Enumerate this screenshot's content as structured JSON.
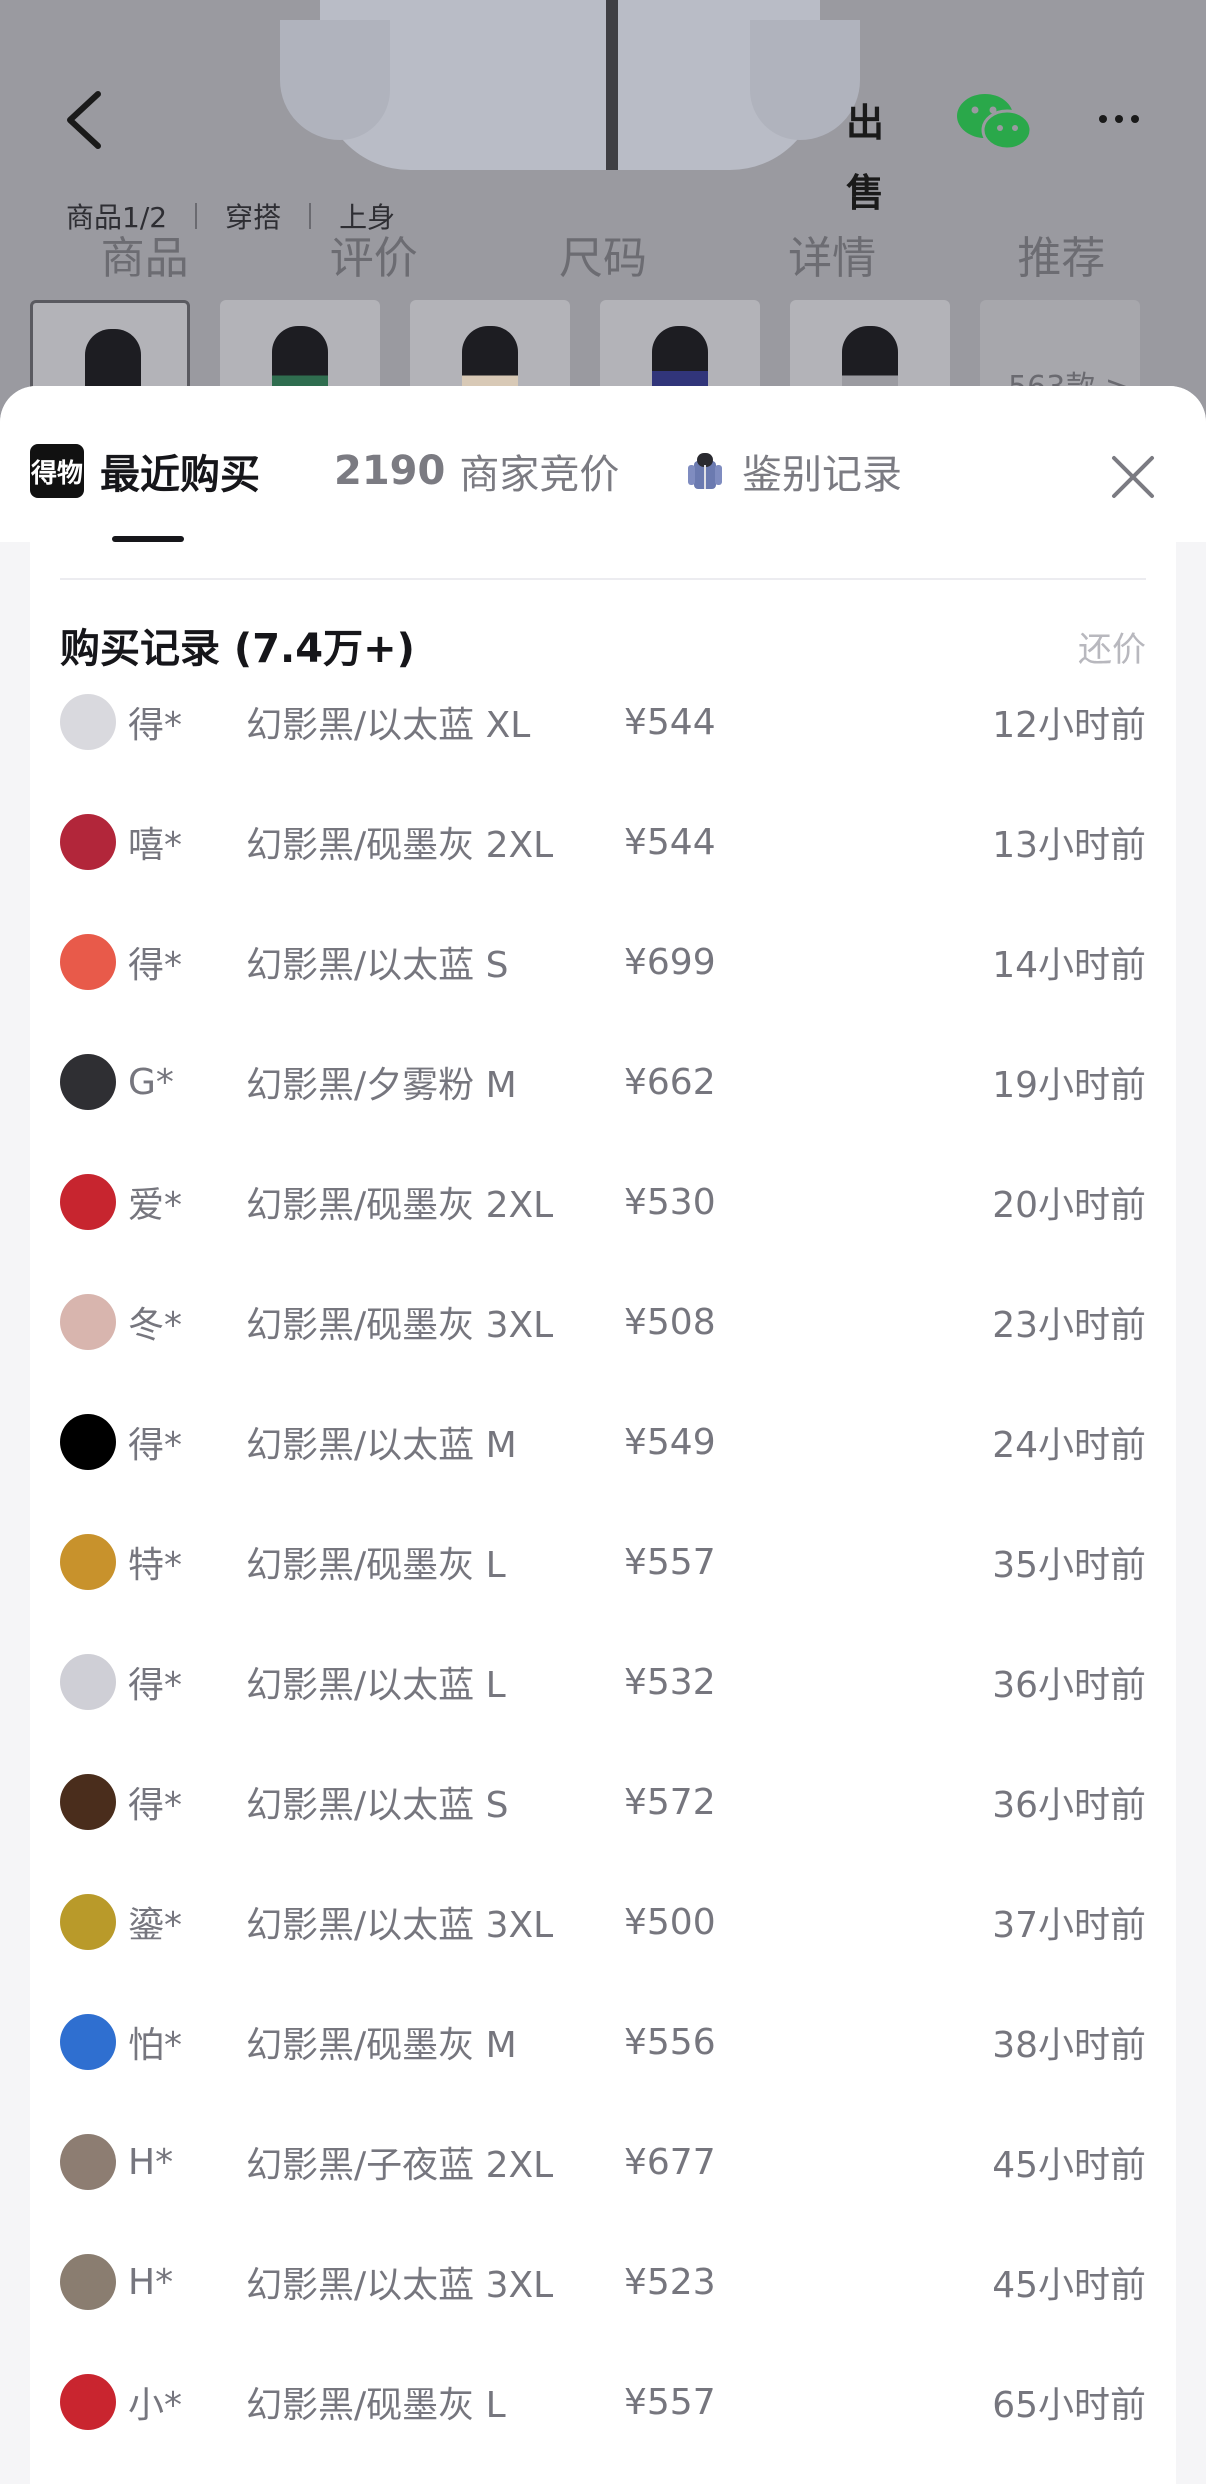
{
  "background": {
    "sell_label": "出售",
    "sub_tabs": [
      "商品1/2",
      "穿搭",
      "上身"
    ],
    "main_tabs": [
      "商品",
      "评价",
      "尺码",
      "详情",
      "推荐"
    ],
    "more_count": "563款 >"
  },
  "sheet": {
    "logo_text": "得物",
    "tabs": {
      "recent": "最近购买",
      "bids_count": "2190",
      "bids_label": "商家竞价",
      "auth_label": "鉴别记录"
    },
    "records_title": "购买记录 (7.4万+)",
    "counter_label": "还价"
  },
  "records": [
    {
      "name": "得*",
      "spec": "幻影黑/以太蓝 XL",
      "price": "¥544",
      "time": "12小时前",
      "avatar_color": "#d9d9de"
    },
    {
      "name": "嘻*",
      "spec": "幻影黑/砚墨灰 2XL",
      "price": "¥544",
      "time": "13小时前",
      "avatar_color": "#b2263a"
    },
    {
      "name": "得*",
      "spec": "幻影黑/以太蓝 S",
      "price": "¥699",
      "time": "14小时前",
      "avatar_color": "#e85a4a"
    },
    {
      "name": "G*",
      "spec": "幻影黑/夕雾粉 M",
      "price": "¥662",
      "time": "19小时前",
      "avatar_color": "#2f2f33"
    },
    {
      "name": "爱*",
      "spec": "幻影黑/砚墨灰 2XL",
      "price": "¥530",
      "time": "20小时前",
      "avatar_color": "#c7252f"
    },
    {
      "name": "冬*",
      "spec": "幻影黑/砚墨灰 3XL",
      "price": "¥508",
      "time": "23小时前",
      "avatar_color": "#d8b5ae"
    },
    {
      "name": "得*",
      "spec": "幻影黑/以太蓝 M",
      "price": "¥549",
      "time": "24小时前",
      "avatar_color": "#000000"
    },
    {
      "name": "特*",
      "spec": "幻影黑/砚墨灰 L",
      "price": "¥557",
      "time": "35小时前",
      "avatar_color": "#c8922c"
    },
    {
      "name": "得*",
      "spec": "幻影黑/以太蓝 L",
      "price": "¥532",
      "time": "36小时前",
      "avatar_color": "#cfcfd6"
    },
    {
      "name": "得*",
      "spec": "幻影黑/以太蓝 S",
      "price": "¥572",
      "time": "36小时前",
      "avatar_color": "#4a2d1c"
    },
    {
      "name": "鎏*",
      "spec": "幻影黑/以太蓝 3XL",
      "price": "¥500",
      "time": "37小时前",
      "avatar_color": "#b99a2a"
    },
    {
      "name": "怕*",
      "spec": "幻影黑/砚墨灰 M",
      "price": "¥556",
      "time": "38小时前",
      "avatar_color": "#2f6fd0"
    },
    {
      "name": "H*",
      "spec": "幻影黑/子夜蓝 2XL",
      "price": "¥677",
      "time": "45小时前",
      "avatar_color": "#8d7d72"
    },
    {
      "name": "H*",
      "spec": "幻影黑/以太蓝 3XL",
      "price": "¥523",
      "time": "45小时前",
      "avatar_color": "#8a7d70"
    },
    {
      "name": "小*",
      "spec": "幻影黑/砚墨灰 L",
      "price": "¥557",
      "time": "65小时前",
      "avatar_color": "#c9252f"
    }
  ]
}
